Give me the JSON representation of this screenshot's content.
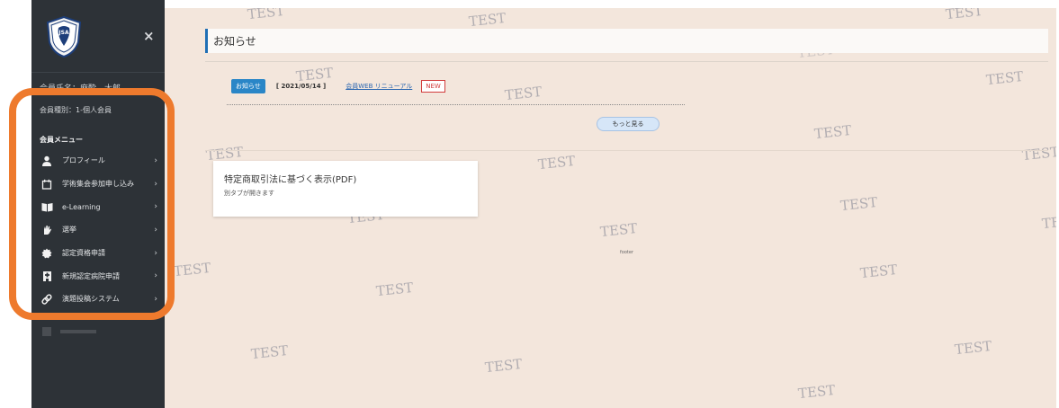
{
  "sidebar": {
    "logo_text": "JSA",
    "close_symbol": "×",
    "member_name": "会員氏名：麻酔　太郎",
    "member_type": "会員種別：1-個人会員",
    "menu_heading": "会員メニュー",
    "items": [
      {
        "label": "プロフィール",
        "icon": "person-icon"
      },
      {
        "label": "学術集会参加申し込み",
        "icon": "calendar-icon"
      },
      {
        "label": "e-Learning",
        "icon": "book-icon"
      },
      {
        "label": "選挙",
        "icon": "hand-icon"
      },
      {
        "label": "認定資格申請",
        "icon": "badge-icon"
      },
      {
        "label": "新規認定病院申請",
        "icon": "hospital-icon"
      },
      {
        "label": "演題投稿システム",
        "icon": "link-icon"
      }
    ],
    "chevron": "›"
  },
  "main": {
    "section_title": "お知らせ",
    "news": {
      "badge": "お知らせ",
      "date": "[ 2021/05/14 ]",
      "link": "会員WEB リニューアル",
      "new_label": "NEW"
    },
    "more_button": "もっと見る",
    "card": {
      "title": "特定商取引法に基づく表示(PDF)",
      "subtitle": "別タブが開きます"
    },
    "footer": "footer",
    "watermark": "TEST"
  },
  "colors": {
    "sidebar_bg": "#2d3237",
    "main_bg": "#f3e6dc",
    "accent_blue": "#2a86c7",
    "highlight_orange": "#ee7a2d",
    "new_red": "#d23c3c"
  }
}
